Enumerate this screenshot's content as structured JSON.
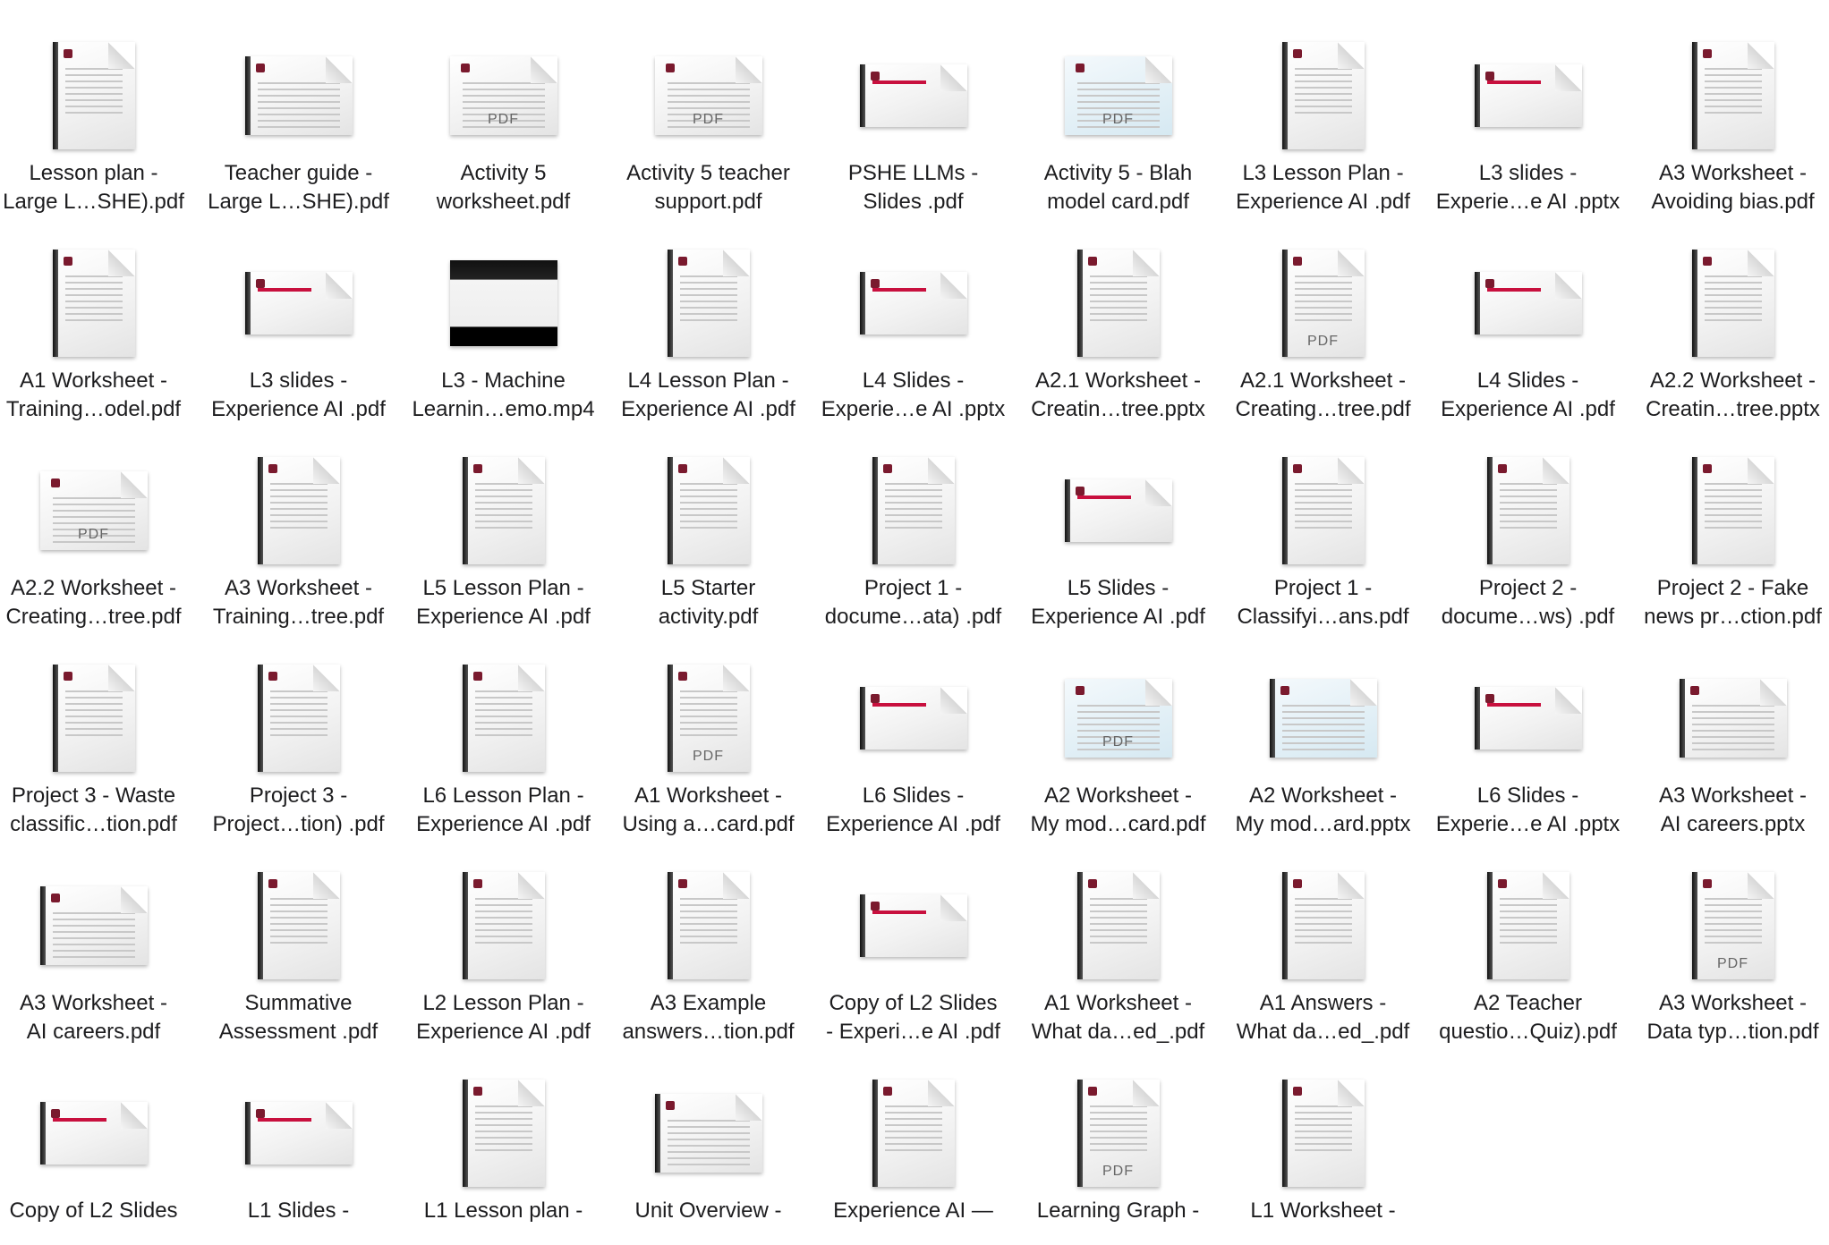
{
  "files": [
    {
      "line1": "Lesson plan -",
      "line2": "Large L…SHE).pdf",
      "kind": "doc",
      "icon": "pdf-document-icon"
    },
    {
      "line1": "Teacher guide -",
      "line2": "Large L…SHE).pdf",
      "kind": "land",
      "icon": "pdf-document-icon"
    },
    {
      "line1": "Activity 5",
      "line2": "worksheet.pdf",
      "kind": "land",
      "pdf": "PDF",
      "icon": "pdf-document-icon"
    },
    {
      "line1": "Activity 5 teacher",
      "line2": "support.pdf",
      "kind": "land",
      "pdf": "PDF",
      "icon": "pdf-document-icon"
    },
    {
      "line1": "PSHE LLMs -",
      "line2": "Slides .pdf",
      "kind": "slide",
      "icon": "slides-icon"
    },
    {
      "line1": "Activity 5 - Blah",
      "line2": "model card.pdf",
      "kind": "land",
      "pdf": "PDF",
      "blue": true,
      "icon": "pdf-document-icon"
    },
    {
      "line1": "L3 Lesson Plan -",
      "line2": "Experience AI .pdf",
      "kind": "doc",
      "icon": "pdf-document-icon"
    },
    {
      "line1": "L3 slides -",
      "line2": "Experie…e AI .pptx",
      "kind": "slide",
      "icon": "slides-icon"
    },
    {
      "line1": "A3 Worksheet -",
      "line2": "Avoiding bias.pdf",
      "kind": "doc",
      "icon": "pdf-document-icon"
    },
    {
      "line1": "A1 Worksheet -",
      "line2": "Training…odel.pdf",
      "kind": "doc",
      "icon": "pdf-document-icon"
    },
    {
      "line1": "L3 slides -",
      "line2": "Experience AI .pdf",
      "kind": "slide",
      "icon": "slides-icon"
    },
    {
      "line1": "L3 - Machine",
      "line2": "Learnin…emo.mp4",
      "kind": "video",
      "icon": "video-icon"
    },
    {
      "line1": "L4 Lesson Plan -",
      "line2": "Experience AI .pdf",
      "kind": "doc",
      "icon": "pdf-document-icon"
    },
    {
      "line1": "L4 Slides -",
      "line2": "Experie…e AI .pptx",
      "kind": "slide",
      "icon": "slides-icon"
    },
    {
      "line1": "A2.1 Worksheet -",
      "line2": "Creatin…tree.pptx",
      "kind": "doc",
      "icon": "slides-icon"
    },
    {
      "line1": "A2.1 Worksheet -",
      "line2": "Creating…tree.pdf",
      "kind": "doc",
      "pdf": "PDF",
      "icon": "pdf-document-icon"
    },
    {
      "line1": "L4 Slides -",
      "line2": "Experience AI .pdf",
      "kind": "slide",
      "icon": "slides-icon"
    },
    {
      "line1": "A2.2 Worksheet -",
      "line2": "Creatin…tree.pptx",
      "kind": "doc",
      "icon": "slides-icon"
    },
    {
      "line1": "A2.2 Worksheet -",
      "line2": "Creating…tree.pdf",
      "kind": "land",
      "pdf": "PDF",
      "icon": "pdf-document-icon"
    },
    {
      "line1": "A3 Worksheet -",
      "line2": "Training…tree.pdf",
      "kind": "doc",
      "icon": "pdf-document-icon"
    },
    {
      "line1": "L5 Lesson Plan -",
      "line2": "Experience AI .pdf",
      "kind": "doc",
      "icon": "pdf-document-icon"
    },
    {
      "line1": "L5 Starter",
      "line2": "activity.pdf",
      "kind": "doc",
      "icon": "pdf-document-icon"
    },
    {
      "line1": "Project 1 -",
      "line2": "docume…ata) .pdf",
      "kind": "doc",
      "icon": "pdf-document-icon"
    },
    {
      "line1": "L5 Slides -",
      "line2": "Experience AI .pdf",
      "kind": "slide",
      "icon": "slides-icon"
    },
    {
      "line1": "Project 1 -",
      "line2": "Classifyi…ans.pdf",
      "kind": "doc",
      "icon": "pdf-document-icon"
    },
    {
      "line1": "Project 2 -",
      "line2": "docume…ws) .pdf",
      "kind": "doc",
      "icon": "pdf-document-icon"
    },
    {
      "line1": "Project 2 - Fake",
      "line2": "news pr…ction.pdf",
      "kind": "doc",
      "icon": "pdf-document-icon"
    },
    {
      "line1": "Project 3 - Waste",
      "line2": "classific…tion.pdf",
      "kind": "doc",
      "icon": "pdf-document-icon"
    },
    {
      "line1": "Project 3 -",
      "line2": "Project…tion) .pdf",
      "kind": "doc",
      "icon": "pdf-document-icon"
    },
    {
      "line1": "L6 Lesson Plan -",
      "line2": "Experience AI .pdf",
      "kind": "doc",
      "icon": "pdf-document-icon"
    },
    {
      "line1": "A1 Worksheet -",
      "line2": "Using a…card.pdf",
      "kind": "doc",
      "pdf": "PDF",
      "icon": "pdf-document-icon"
    },
    {
      "line1": "L6 Slides -",
      "line2": "Experience AI .pdf",
      "kind": "slide",
      "icon": "slides-icon"
    },
    {
      "line1": "A2 Worksheet -",
      "line2": "My mod…card.pdf",
      "kind": "land",
      "pdf": "PDF",
      "blue": true,
      "icon": "pdf-document-icon"
    },
    {
      "line1": "A2 Worksheet -",
      "line2": "My mod…ard.pptx",
      "kind": "land",
      "blue": true,
      "icon": "slides-icon"
    },
    {
      "line1": "L6 Slides -",
      "line2": "Experie…e AI .pptx",
      "kind": "slide",
      "icon": "slides-icon"
    },
    {
      "line1": "A3 Worksheet -",
      "line2": "AI careers.pptx",
      "kind": "land",
      "icon": "slides-icon"
    },
    {
      "line1": "A3 Worksheet -",
      "line2": "AI careers.pdf",
      "kind": "land",
      "icon": "pdf-document-icon"
    },
    {
      "line1": "Summative",
      "line2": "Assessment .pdf",
      "kind": "doc",
      "icon": "pdf-document-icon"
    },
    {
      "line1": "L2 Lesson Plan -",
      "line2": "Experience AI .pdf",
      "kind": "doc",
      "icon": "pdf-document-icon"
    },
    {
      "line1": "A3 Example",
      "line2": "answers…tion.pdf",
      "kind": "doc",
      "icon": "pdf-document-icon"
    },
    {
      "line1": "Copy of L2 Slides",
      "line2": "- Experi…e AI .pdf",
      "kind": "slide",
      "icon": "slides-icon"
    },
    {
      "line1": "A1 Worksheet -",
      "line2": "What da…ed_.pdf",
      "kind": "doc",
      "icon": "pdf-document-icon"
    },
    {
      "line1": "A1 Answers -",
      "line2": "What da…ed_.pdf",
      "kind": "doc",
      "icon": "pdf-document-icon"
    },
    {
      "line1": "A2 Teacher",
      "line2": "questio…Quiz).pdf",
      "kind": "doc",
      "icon": "pdf-document-icon"
    },
    {
      "line1": "A3 Worksheet -",
      "line2": "Data typ…tion.pdf",
      "kind": "doc",
      "pdf": "PDF",
      "icon": "pdf-document-icon"
    },
    {
      "line1": "Copy of L2 Slides",
      "line2": "",
      "kind": "slide",
      "icon": "slides-icon"
    },
    {
      "line1": "L1 Slides -",
      "line2": "",
      "kind": "slide",
      "icon": "slides-icon"
    },
    {
      "line1": "L1 Lesson plan -",
      "line2": "",
      "kind": "doc",
      "icon": "pdf-document-icon"
    },
    {
      "line1": "Unit Overview -",
      "line2": "",
      "kind": "land",
      "icon": "pdf-document-icon"
    },
    {
      "line1": "Experience AI —",
      "line2": "",
      "kind": "doc",
      "icon": "pdf-document-icon"
    },
    {
      "line1": "Learning Graph -",
      "line2": "",
      "kind": "doc",
      "pdf": "PDF",
      "icon": "pdf-document-icon"
    },
    {
      "line1": "L1 Worksheet -",
      "line2": "",
      "kind": "doc",
      "icon": "pdf-document-icon"
    }
  ]
}
